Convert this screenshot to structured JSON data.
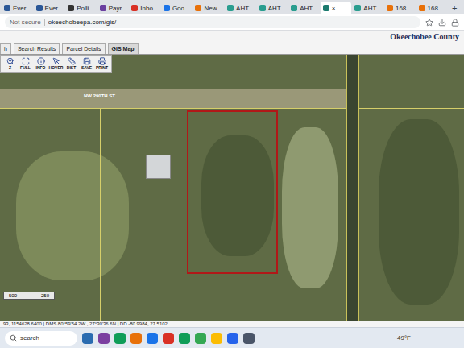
{
  "browser": {
    "tabs": [
      {
        "label": "Ever",
        "selected": false,
        "color": "#2b5797"
      },
      {
        "label": "Ever",
        "selected": false,
        "color": "#2b5797"
      },
      {
        "label": "Polli",
        "selected": false,
        "color": "#333333"
      },
      {
        "label": "Payr",
        "selected": false,
        "color": "#6b3fa0"
      },
      {
        "label": "Inbo",
        "selected": false,
        "color": "#d93025"
      },
      {
        "label": "Goo",
        "selected": false,
        "color": "#1a73e8"
      },
      {
        "label": "New",
        "selected": false,
        "color": "#e8710a"
      },
      {
        "label": "AHT",
        "selected": false,
        "color": "#2a9d8f"
      },
      {
        "label": "AHT",
        "selected": false,
        "color": "#2a9d8f"
      },
      {
        "label": "AHT",
        "selected": false,
        "color": "#2a9d8f"
      },
      {
        "label": "×",
        "selected": true,
        "color": "#1b7a6e"
      },
      {
        "label": "AHT",
        "selected": false,
        "color": "#2a9d8f"
      },
      {
        "label": "168",
        "selected": false,
        "color": "#e8710a"
      },
      {
        "label": "168",
        "selected": false,
        "color": "#e8710a"
      }
    ],
    "new_tab": "+"
  },
  "address": {
    "security": "Not secure",
    "url": "okeechobeepa.com/gis/"
  },
  "page": {
    "brand": "Okeechobee County",
    "tabs": [
      {
        "label": "h",
        "selected": false
      },
      {
        "label": "Search Results",
        "selected": false
      },
      {
        "label": "Parcel Details",
        "selected": false
      },
      {
        "label": "GIS Map",
        "selected": true
      }
    ],
    "tools": [
      {
        "label": "Z"
      },
      {
        "label": "FULL"
      },
      {
        "label": "INFO"
      },
      {
        "label": "HOVER"
      },
      {
        "label": "DIST"
      },
      {
        "label": "SAVE"
      },
      {
        "label": "PRINT"
      }
    ]
  },
  "map": {
    "street": "NW 290TH ST",
    "scale": [
      "500",
      "250"
    ]
  },
  "status": "93, 1154628.6400 | DMS 80°59'54.2W , 27°30'36.6N | DD -80.9984, 27.5102",
  "taskbar": {
    "search": "search",
    "apps": [
      {
        "color": "#2b6cb0"
      },
      {
        "color": "#7b3fa0"
      },
      {
        "color": "#0f9d58"
      },
      {
        "color": "#e8710a"
      },
      {
        "color": "#1a73e8"
      },
      {
        "color": "#d93025"
      },
      {
        "color": "#0f9d58"
      },
      {
        "color": "#34a853"
      },
      {
        "color": "#fbbc04"
      },
      {
        "color": "#2563eb"
      },
      {
        "color": "#4a5568"
      }
    ],
    "temperature": "49°F"
  }
}
